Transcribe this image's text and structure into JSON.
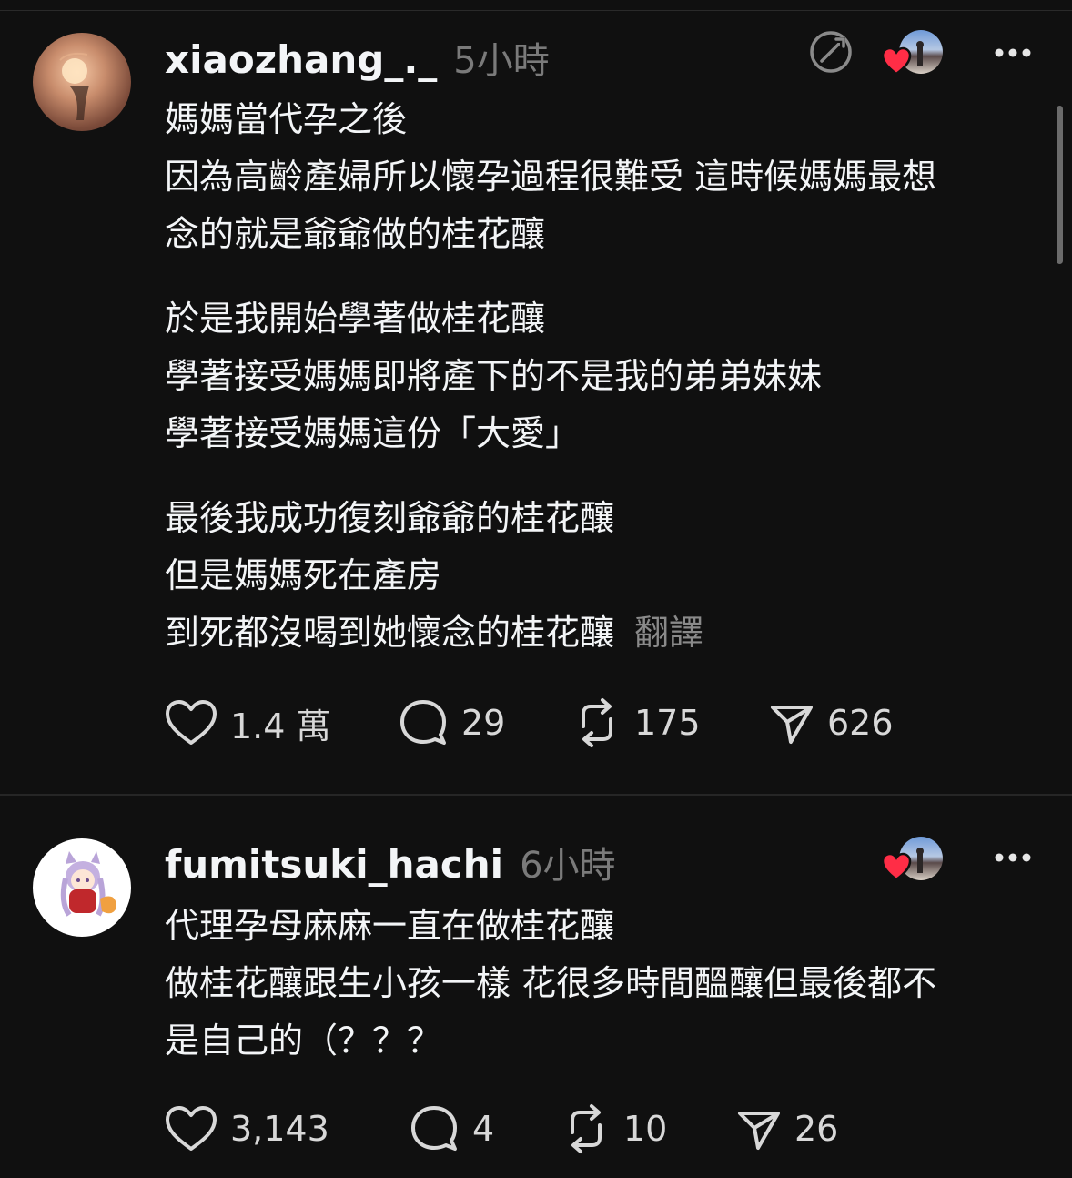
{
  "posts": [
    {
      "username": "xiaozhang_._",
      "time": "5小時",
      "paragraphs": [
        [
          "媽媽當代孕之後",
          "因為高齡產婦所以懷孕過程很難受 這時候媽媽最想",
          "念的就是爺爺做的桂花釀"
        ],
        [
          "於是我開始學著做桂花釀",
          "學著接受媽媽即將產下的不是我的弟弟妹妹",
          "學著接受媽媽這份「大愛」"
        ],
        [
          "最後我成功復刻爺爺的桂花釀",
          "但是媽媽死在產房",
          "到死都沒喝到她懷念的桂花釀"
        ]
      ],
      "translate_label": "翻譯",
      "likes": "1.4 萬",
      "replies": "29",
      "reposts": "175",
      "shares": "626"
    },
    {
      "username": "fumitsuki_hachi",
      "time": "6小時",
      "paragraphs": [
        [
          "代理孕母麻麻一直在做桂花釀",
          "做桂花釀跟生小孩一樣 花很多時間醞釀但最後都不",
          "是自己的（？？？"
        ]
      ],
      "likes": "3,143",
      "replies": "4",
      "reposts": "10",
      "shares": "26"
    }
  ],
  "colors": {
    "background": "#101010",
    "text": "#f3f5f7",
    "muted": "#7a7a7a",
    "heart": "#ff2d46"
  },
  "icons": [
    "mention-icon",
    "heart-icon",
    "reply-icon",
    "repost-icon",
    "share-icon",
    "more-icon"
  ]
}
